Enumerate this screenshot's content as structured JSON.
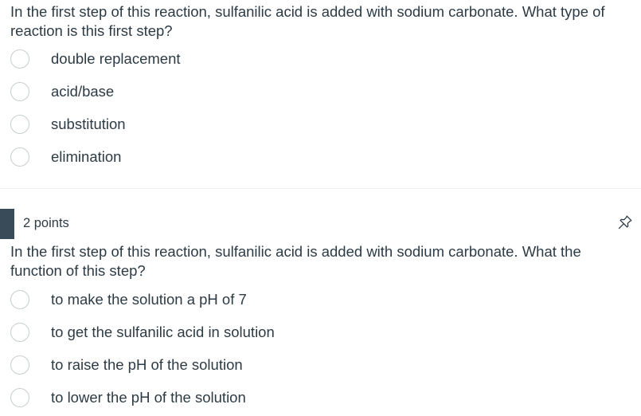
{
  "question1": {
    "text": "In the first step of this reaction, sulfanilic acid is added with sodium carbonate. What type of reaction is this first step?",
    "answers": [
      {
        "label": "double replacement"
      },
      {
        "label": "acid/base"
      },
      {
        "label": "substitution"
      },
      {
        "label": "elimination"
      }
    ]
  },
  "question2": {
    "points": "2 points",
    "pin_icon": "pin-icon",
    "text": "In the first step of this reaction, sulfanilic acid is added with sodium carbonate. What the function of this step?",
    "answers": [
      {
        "label": "to make the solution a pH of 7"
      },
      {
        "label": "to get the sulfanilic acid in solution"
      },
      {
        "label": "to raise the pH of the solution"
      },
      {
        "label": "to lower the pH of the solution"
      }
    ]
  },
  "colors": {
    "text": "#2d3b45",
    "radio_border": "#c7cdd1",
    "header_bar": "#394b58"
  }
}
